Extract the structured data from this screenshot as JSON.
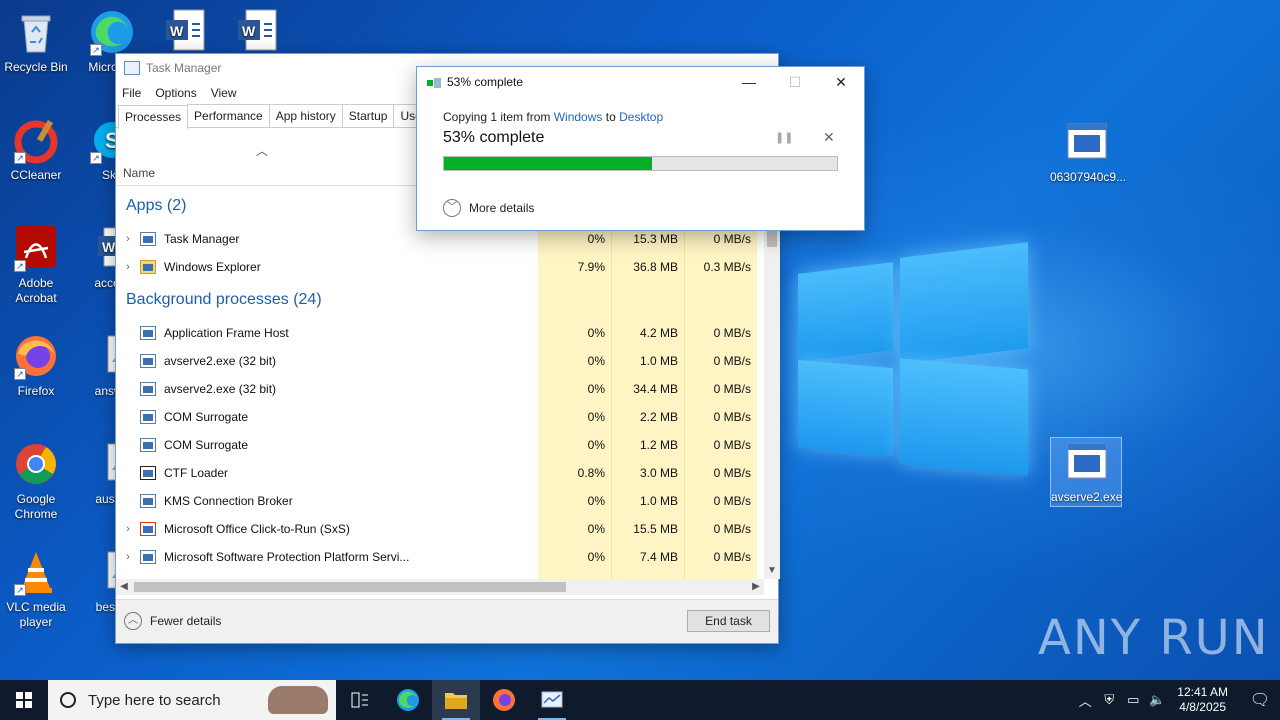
{
  "desktop": {
    "icons": [
      {
        "label": "Recycle Bin"
      },
      {
        "label": "Micro Ed"
      },
      {
        "label": "CCleaner"
      },
      {
        "label": "Sky"
      },
      {
        "label": "Adobe Acrobat"
      },
      {
        "label": "accept"
      },
      {
        "label": "Firefox"
      },
      {
        "label": "answe"
      },
      {
        "label": "Google Chrome"
      },
      {
        "label": "austra"
      },
      {
        "label": "VLC media player"
      },
      {
        "label": "bestm"
      },
      {
        "label": "06307940c9..."
      },
      {
        "label": "avserve2.exe"
      }
    ],
    "watermark": "ANY RUN"
  },
  "task_manager": {
    "title": "Task Manager",
    "menu": [
      "File",
      "Options",
      "View"
    ],
    "tabs": [
      "Processes",
      "Performance",
      "App history",
      "Startup",
      "Users"
    ],
    "column_name": "Name",
    "groups": {
      "apps": "Apps (2)",
      "background": "Background processes (24)"
    },
    "apps": [
      {
        "name": "Task Manager",
        "cpu": "0%",
        "mem": "15.3 MB",
        "disk": "0 MB/s"
      },
      {
        "name": "Windows Explorer",
        "cpu": "7.9%",
        "mem": "36.8 MB",
        "disk": "0.3 MB/s"
      }
    ],
    "background": [
      {
        "name": "Application Frame Host",
        "cpu": "0%",
        "mem": "4.2 MB",
        "disk": "0 MB/s"
      },
      {
        "name": "avserve2.exe (32 bit)",
        "cpu": "0%",
        "mem": "1.0 MB",
        "disk": "0 MB/s"
      },
      {
        "name": "avserve2.exe (32 bit)",
        "cpu": "0%",
        "mem": "34.4 MB",
        "disk": "0 MB/s"
      },
      {
        "name": "COM Surrogate",
        "cpu": "0%",
        "mem": "2.2 MB",
        "disk": "0 MB/s"
      },
      {
        "name": "COM Surrogate",
        "cpu": "0%",
        "mem": "1.2 MB",
        "disk": "0 MB/s"
      },
      {
        "name": "CTF Loader",
        "cpu": "0.8%",
        "mem": "3.0 MB",
        "disk": "0 MB/s"
      },
      {
        "name": "KMS Connection Broker",
        "cpu": "0%",
        "mem": "1.0 MB",
        "disk": "0 MB/s"
      },
      {
        "name": "Microsoft Office Click-to-Run (SxS)",
        "cpu": "0%",
        "mem": "15.5 MB",
        "disk": "0 MB/s"
      },
      {
        "name": "Microsoft Software Protection Platform Servi...",
        "cpu": "0%",
        "mem": "7.4 MB",
        "disk": "0 MB/s"
      }
    ],
    "fewer_details": "Fewer details",
    "end_task": "End task"
  },
  "copy_dialog": {
    "title": "53% complete",
    "copying_prefix": "Copying 1 item from",
    "source": "Windows",
    "to_word": "to",
    "destination": "Desktop",
    "percent_text": "53% complete",
    "progress": 0.53,
    "more_details": "More details",
    "accent_color": "#06b025"
  },
  "taskbar": {
    "search_placeholder": "Type here to search",
    "time": "12:41 AM",
    "date": "4/8/2025"
  }
}
